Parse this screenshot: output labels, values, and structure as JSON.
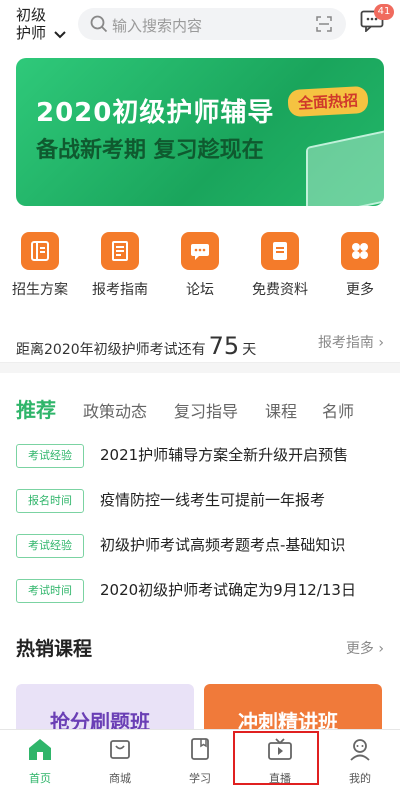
{
  "header": {
    "exam_line1": "初级",
    "exam_line2": "护师",
    "search_placeholder": "输入搜索内容",
    "message_badge": "41"
  },
  "banner": {
    "title": "2020初级护师辅导",
    "subtitle": "备战新考期  复习趁现在",
    "tag": "全面热招"
  },
  "quick_nav": [
    {
      "label": "招生方案",
      "icon": "book-list-icon"
    },
    {
      "label": "报考指南",
      "icon": "guide-book-icon"
    },
    {
      "label": "论坛",
      "icon": "chat-bubble-icon"
    },
    {
      "label": "免费资料",
      "icon": "document-icon"
    },
    {
      "label": "更多",
      "icon": "grid-more-icon"
    }
  ],
  "countdown": {
    "prefix": "距离2020年初级护师考试还有",
    "days": "75",
    "suffix": "天",
    "link": "报考指南 ›"
  },
  "tabs": [
    "推荐",
    "政策动态",
    "复习指导",
    "课程",
    "名师"
  ],
  "news": [
    {
      "tag": "考试经验",
      "title": "2021护师辅导方案全新升级开启预售"
    },
    {
      "tag": "报名时间",
      "title": "疫情防控一线考生可提前一年报考"
    },
    {
      "tag": "考试经验",
      "title": "初级护师考试高频考题考点-基础知识"
    },
    {
      "tag": "考试时间",
      "title": "2020初级护师考试确定为9月12/13日"
    }
  ],
  "hot": {
    "title": "热销课程",
    "more": "更多 ›",
    "card1": "抢分刷题班",
    "card2": "冲刺精讲班"
  },
  "bottom_nav": [
    {
      "label": "首页",
      "icon": "home-icon",
      "active": true
    },
    {
      "label": "商城",
      "icon": "shopping-bag-icon"
    },
    {
      "label": "学习",
      "icon": "notebook-icon"
    },
    {
      "label": "直播",
      "icon": "live-tv-icon"
    },
    {
      "label": "我的",
      "icon": "user-icon"
    }
  ],
  "colors": {
    "accent": "#2fb56a",
    "orange": "#f47b2a",
    "highlight": "#e02020"
  }
}
